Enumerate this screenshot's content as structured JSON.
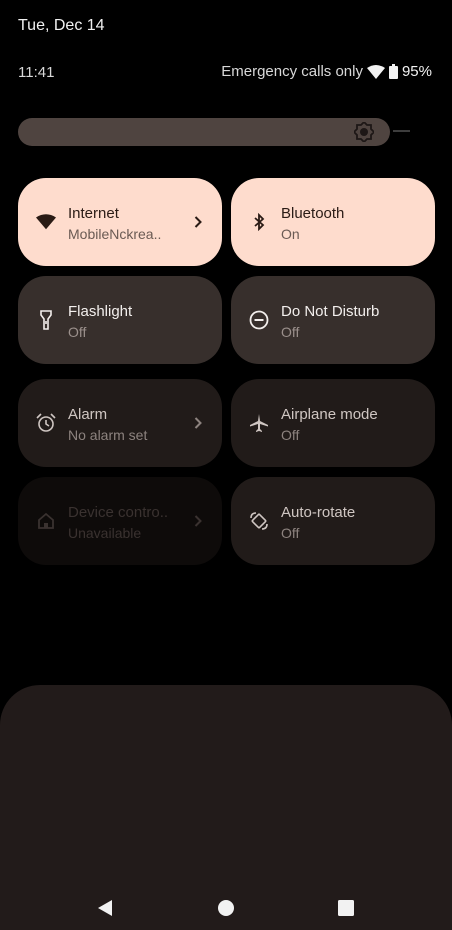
{
  "header": {
    "date": "Tue, Dec 14",
    "time": "11:41"
  },
  "status_bar": {
    "carrier_text": "Emergency calls only",
    "battery_percent": "95%",
    "wifi_icon": "wifi-icon",
    "battery_icon": "battery-icon"
  },
  "brightness": {
    "icon": "brightness-icon",
    "level": 0.9
  },
  "tiles": [
    {
      "title": "Internet",
      "subtitle": "MobileNckrea..",
      "icon": "wifi-icon",
      "state": "active",
      "chevron": true
    },
    {
      "title": "Bluetooth",
      "subtitle": "On",
      "icon": "bluetooth-icon",
      "state": "active",
      "chevron": false
    },
    {
      "title": "Flashlight",
      "subtitle": "Off",
      "icon": "flashlight-icon",
      "state": "inactive",
      "chevron": false
    },
    {
      "title": "Do Not Disturb",
      "subtitle": "Off",
      "icon": "do-not-disturb-icon",
      "state": "inactive",
      "chevron": false
    },
    {
      "title": "Alarm",
      "subtitle": "No alarm set",
      "icon": "alarm-icon",
      "state": "dim",
      "chevron": true
    },
    {
      "title": "Airplane mode",
      "subtitle": "Off",
      "icon": "airplane-icon",
      "state": "dim",
      "chevron": false
    },
    {
      "title": "Device contro..",
      "subtitle": "Unavailable",
      "icon": "home-icon",
      "state": "disabled",
      "chevron": true
    },
    {
      "title": "Auto-rotate",
      "subtitle": "Off",
      "icon": "auto-rotate-icon",
      "state": "dim",
      "chevron": false
    }
  ],
  "nav_bar": {
    "back_icon": "back-icon",
    "home_icon": "home-button-icon",
    "recents_icon": "recents-icon"
  },
  "colors": {
    "tile_active": "#fedccd",
    "tile_inactive": "#372f2c",
    "tile_dim": "#211b19",
    "tile_disabled": "#0e0b0a",
    "sheet": "#221b1a"
  }
}
